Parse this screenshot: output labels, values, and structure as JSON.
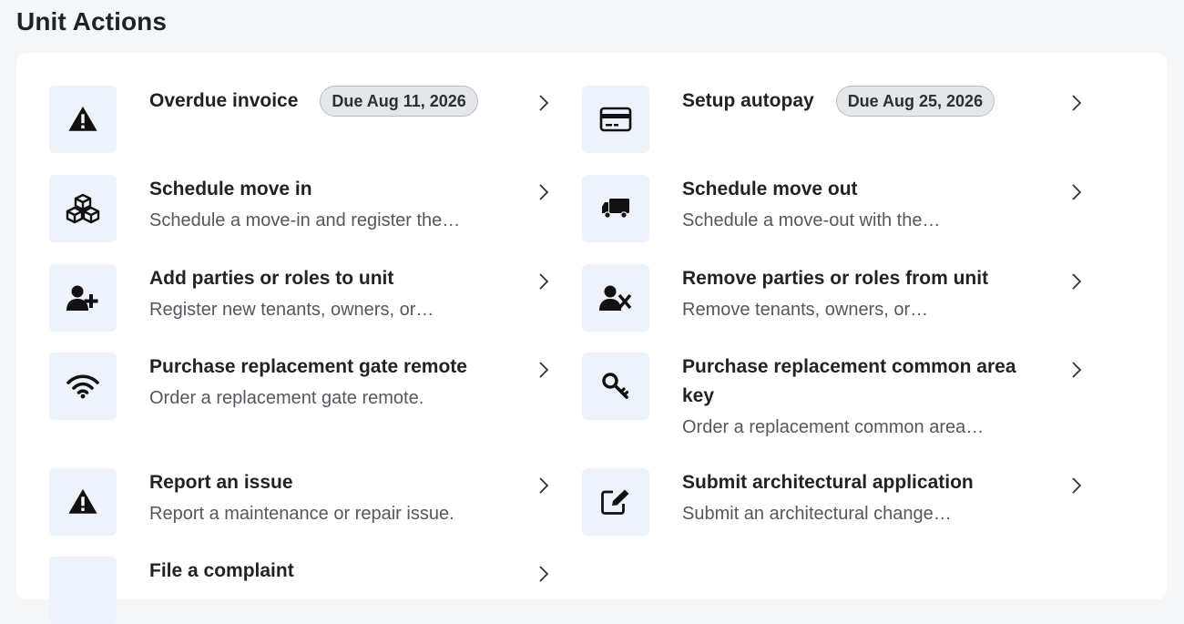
{
  "page": {
    "title": "Unit Actions"
  },
  "actions": [
    {
      "title": "Overdue invoice",
      "badge": "Due Aug 11, 2026",
      "description": "",
      "icon": "warning-icon"
    },
    {
      "title": "Setup autopay",
      "badge": "Due Aug 25, 2026",
      "description": "",
      "icon": "credit-card-icon"
    },
    {
      "title": "Schedule move in",
      "badge": "",
      "description": "Schedule a move-in and register the…",
      "icon": "boxes-icon"
    },
    {
      "title": "Schedule move out",
      "badge": "",
      "description": "Schedule a move-out with the…",
      "icon": "truck-icon"
    },
    {
      "title": "Add parties or roles to unit",
      "badge": "",
      "description": "Register new tenants, owners, or…",
      "icon": "user-plus-icon"
    },
    {
      "title": "Remove parties or roles from unit",
      "badge": "",
      "description": "Remove tenants, owners, or…",
      "icon": "user-remove-icon"
    },
    {
      "title": "Purchase replacement gate remote",
      "badge": "",
      "description": "Order a replacement gate remote.",
      "icon": "wifi-icon"
    },
    {
      "title": "Purchase replacement common area key",
      "badge": "",
      "description": "Order a replacement common area…",
      "icon": "key-icon"
    },
    {
      "title": "Report an issue",
      "badge": "",
      "description": "Report a maintenance or repair issue.",
      "icon": "warning-icon"
    },
    {
      "title": "Submit architectural application",
      "badge": "",
      "description": "Submit an architectural change…",
      "icon": "edit-icon"
    },
    {
      "title": "File a complaint",
      "badge": "",
      "description": "",
      "icon": "complaint-icon"
    }
  ]
}
